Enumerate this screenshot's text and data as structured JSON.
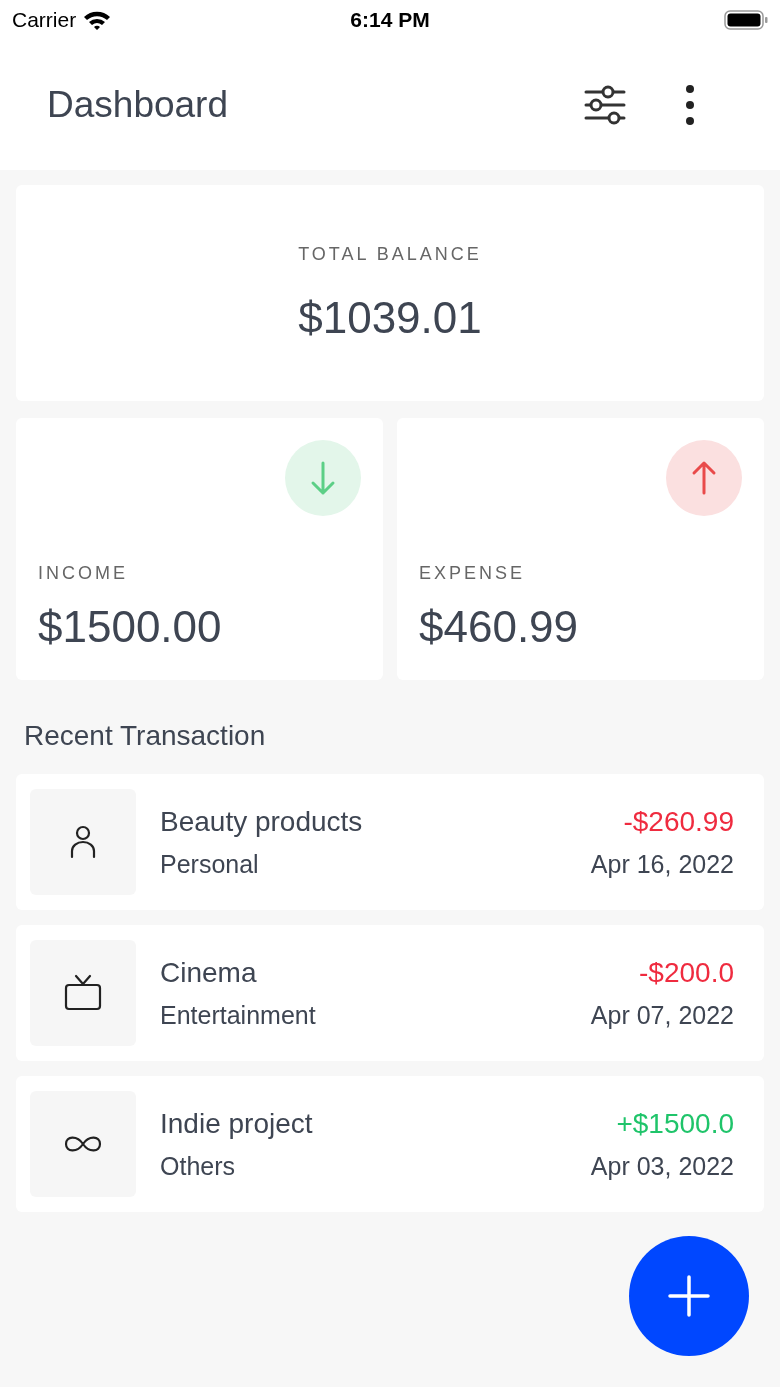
{
  "status_bar": {
    "carrier": "Carrier",
    "time": "6:14 PM"
  },
  "header": {
    "title": "Dashboard"
  },
  "balance": {
    "label": "TOTAL BALANCE",
    "amount": "$1039.01"
  },
  "stats": [
    {
      "kind": "income",
      "label": "INCOME",
      "amount": "$1500.00"
    },
    {
      "kind": "expense",
      "label": "EXPENSE",
      "amount": "$460.99"
    }
  ],
  "section_title": "Recent Transaction",
  "transactions": [
    {
      "kind": "person",
      "title": "Beauty products",
      "category": "Personal",
      "color": "#ef2b3f",
      "amount": "-$260.99",
      "date": "Apr 16, 2022"
    },
    {
      "kind": "tv",
      "title": "Cinema",
      "category": "Entertainment",
      "color": "#ef2b3f",
      "amount": "-$200.0",
      "date": "Apr 07, 2022"
    },
    {
      "kind": "infinity",
      "title": "Indie project",
      "category": "Others",
      "color": "#1fc46a",
      "amount": "+$1500.0",
      "date": "Apr 03, 2022"
    }
  ]
}
